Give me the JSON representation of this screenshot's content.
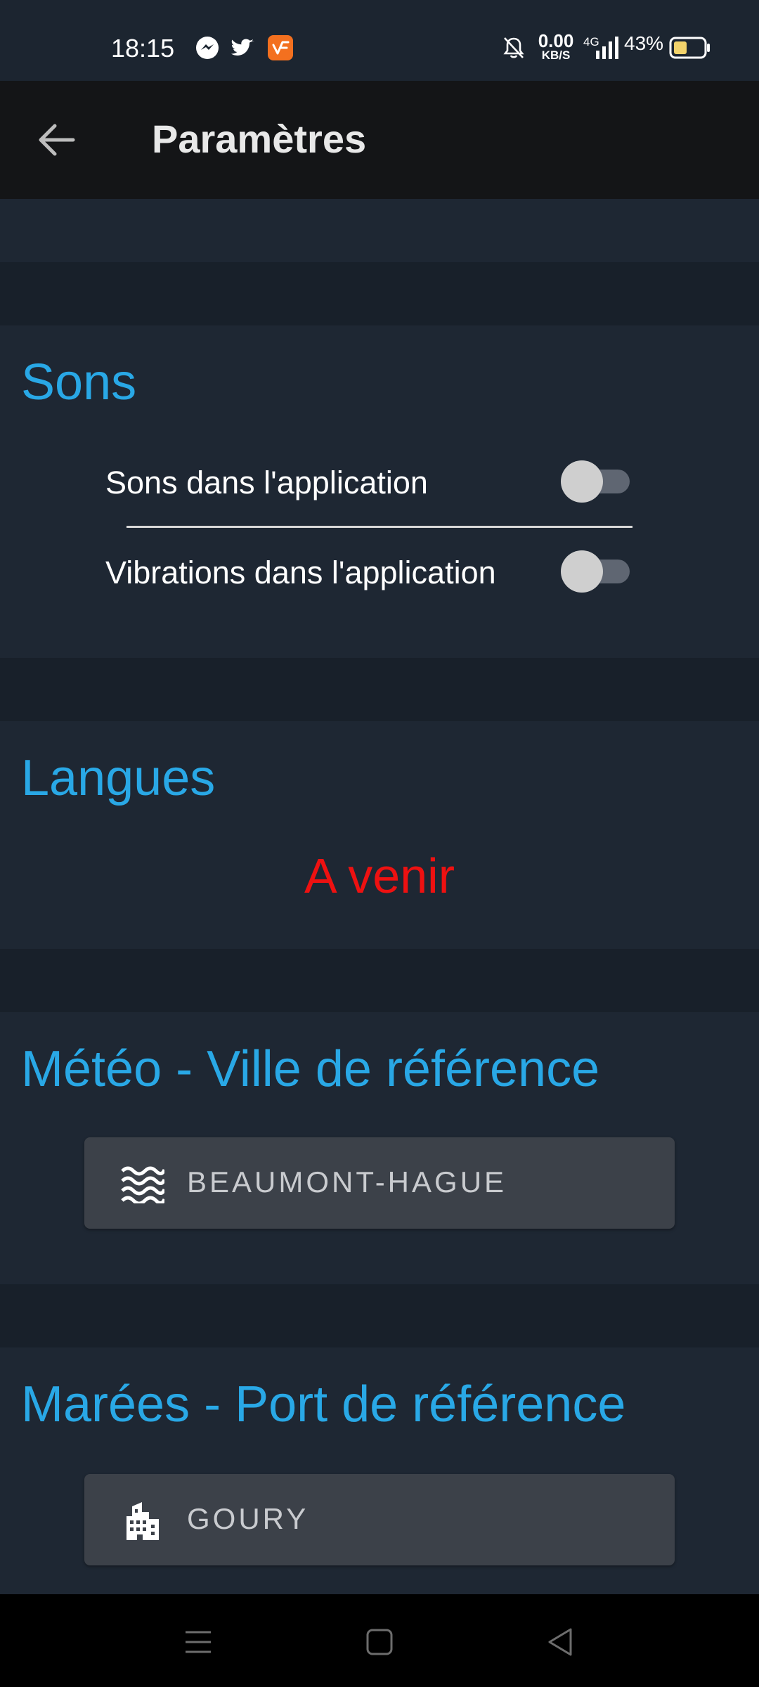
{
  "status_bar": {
    "time": "18:15",
    "data_rate_value": "0.00",
    "data_rate_unit": "KB/S",
    "network": "4G",
    "battery": "43%",
    "notification_icons": [
      "messenger-icon",
      "twitter-icon",
      "app-orange-icon"
    ],
    "system_icons": [
      "bell-off-icon",
      "signal-icon",
      "battery-icon"
    ]
  },
  "app_bar": {
    "title": "Paramètres",
    "back_icon": "arrow-left-icon"
  },
  "sections": {
    "sounds": {
      "title": "Sons",
      "items": [
        {
          "label": "Sons dans l'application",
          "enabled": false
        },
        {
          "label": "Vibrations dans l'application",
          "enabled": false
        }
      ]
    },
    "languages": {
      "title": "Langues",
      "message": "A venir"
    },
    "weather": {
      "title": "Météo - Ville de référence",
      "value": "BEAUMONT-HAGUE",
      "icon": "waves-icon"
    },
    "tides": {
      "title": "Marées - Port de référence",
      "value": "GOURY",
      "icon": "building-icon"
    }
  },
  "nav_bar": {
    "icons": [
      "menu-icon",
      "home-icon",
      "back-icon"
    ]
  },
  "colors": {
    "accent": "#29a8e6",
    "warning": "#ee1111",
    "background": "#1e2733",
    "app_bar": "#141517"
  }
}
